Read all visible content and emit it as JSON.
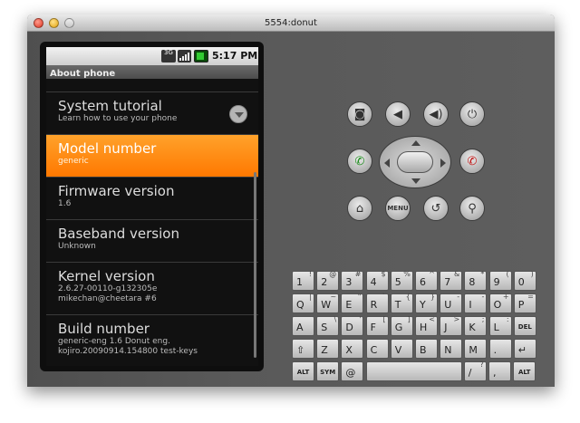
{
  "window": {
    "title": "5554:donut"
  },
  "status": {
    "net": "3G",
    "time": "5:17 PM"
  },
  "app": {
    "title": "About phone"
  },
  "rows": [
    {
      "title": "System tutorial",
      "sub": "Learn how to use your phone"
    },
    {
      "title": "Model number",
      "sub": "generic"
    },
    {
      "title": "Firmware version",
      "sub": "1.6"
    },
    {
      "title": "Baseband version",
      "sub": "Unknown"
    },
    {
      "title": "Kernel version",
      "sub": "2.6.27-00110-g132305e",
      "sub2": "mikechan@cheetara #6"
    },
    {
      "title": "Build number",
      "sub": "generic-eng 1.6 Donut eng.",
      "sub2": "kojiro.20090914.154800 test-keys"
    }
  ],
  "buttons": {
    "menu": "MENU"
  },
  "keyboard": {
    "r1": [
      [
        "1",
        "!"
      ],
      [
        "2",
        "@"
      ],
      [
        "3",
        "#"
      ],
      [
        "4",
        "$"
      ],
      [
        "5",
        "%"
      ],
      [
        "6",
        "^"
      ],
      [
        "7",
        "&"
      ],
      [
        "8",
        "*"
      ],
      [
        "9",
        "("
      ],
      [
        "0",
        ")"
      ]
    ],
    "r2": [
      [
        "Q",
        "|"
      ],
      [
        "W",
        "~"
      ],
      [
        "E",
        "\""
      ],
      [
        "R",
        "`"
      ],
      [
        "T",
        "{"
      ],
      [
        "Y",
        "}"
      ],
      [
        "U",
        "-"
      ],
      [
        "I",
        "-"
      ],
      [
        "O",
        "+"
      ],
      [
        "P",
        "="
      ]
    ],
    "r3": [
      [
        "A",
        ""
      ],
      [
        "S",
        "\\"
      ],
      [
        "D",
        "'"
      ],
      [
        "F",
        "["
      ],
      [
        "G",
        "]"
      ],
      [
        "H",
        "<"
      ],
      [
        "J",
        ">"
      ],
      [
        "K",
        ";"
      ],
      [
        "L",
        ":"
      ],
      [
        "DEL",
        ""
      ]
    ],
    "r4": [
      [
        "⇧",
        ""
      ],
      [
        "Z",
        ""
      ],
      [
        "X",
        ""
      ],
      [
        "C",
        ""
      ],
      [
        "V",
        ""
      ],
      [
        "B",
        ""
      ],
      [
        "N",
        ""
      ],
      [
        "M",
        ""
      ],
      [
        ".",
        ""
      ],
      [
        "↵",
        ""
      ]
    ],
    "r5": [
      [
        "ALT",
        ""
      ],
      [
        "SYM",
        ""
      ],
      [
        "@",
        ""
      ],
      [
        "",
        ""
      ],
      [
        "/",
        "?"
      ],
      [
        ",",
        ""
      ],
      [
        "ALT",
        ""
      ]
    ]
  }
}
